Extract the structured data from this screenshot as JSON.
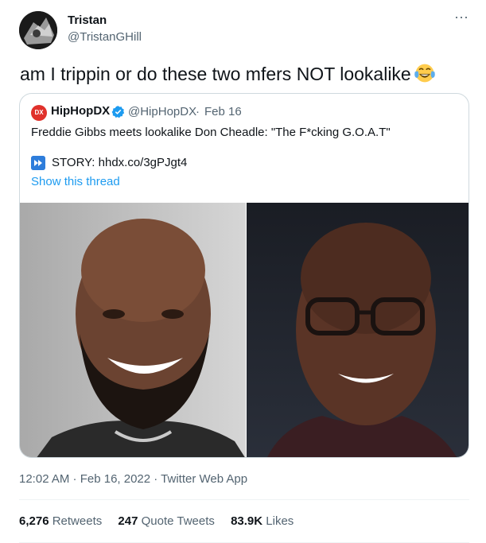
{
  "author": {
    "name": "Tristan",
    "handle": "@TristanGHill",
    "avatar_icon": "avatar-photo"
  },
  "tweet": {
    "text": "am I trippin or do these two mfers NOT lookalike",
    "emoji_icon": "face-with-tears-of-joy-icon",
    "more_icon": "more-dots-icon"
  },
  "quote": {
    "source_name": "HipHopDX",
    "logo_text": "DX",
    "verified_icon": "verified-badge-icon",
    "source_handle": "@HipHopDX",
    "separator": "·",
    "date": "Feb 16",
    "text": "Freddie Gibbs meets lookalike Don Cheadle: \"The F*cking G.O.A.T\"",
    "story_icon": "fast-forward-icon",
    "story_text": "STORY: hhdx.co/3gPJgt4",
    "show_thread": "Show this thread",
    "images": [
      "freddie-gibbs-photo",
      "don-cheadle-photo"
    ]
  },
  "meta": {
    "timestamp": "12:02 AM · Feb 16, 2022 · Twitter Web App"
  },
  "stats": {
    "retweets_count": "6,276",
    "retweets_label": "Retweets",
    "quotes_count": "247",
    "quotes_label": "Quote Tweets",
    "likes_count": "83.9K",
    "likes_label": "Likes"
  },
  "colors": {
    "accent": "#1d9bf0",
    "secondary_text": "#536471",
    "border": "#cfd9de",
    "hiphopdx_red": "#e0312b"
  }
}
